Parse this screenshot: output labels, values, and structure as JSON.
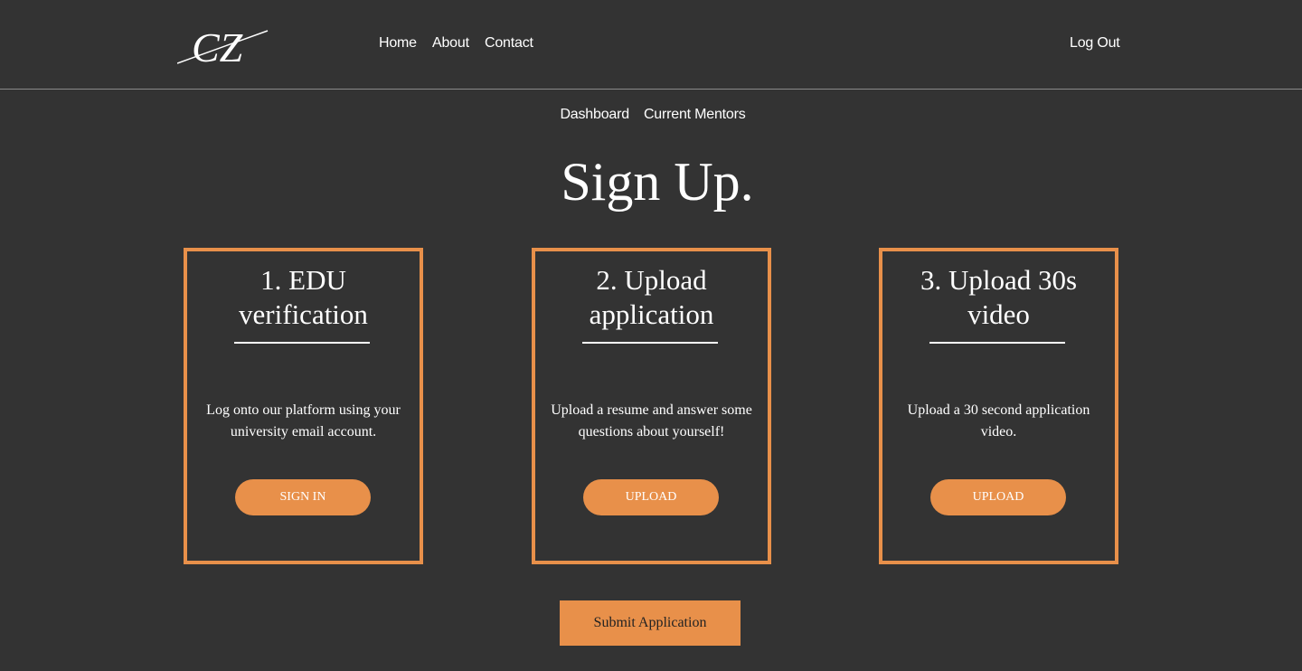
{
  "brand": {
    "logo_text": "CZ"
  },
  "nav": {
    "home": "Home",
    "about": "About",
    "contact": "Contact",
    "logout": "Log Out"
  },
  "subnav": {
    "dashboard": "Dashboard",
    "mentors": "Current Mentors"
  },
  "page": {
    "title": "Sign Up."
  },
  "steps": [
    {
      "title_line1": "1. EDU",
      "title_line2": "verification",
      "description": "Log onto our platform using your university email account.",
      "button": "Sign In"
    },
    {
      "title_line1": "2. Upload",
      "title_line2": "application",
      "description": "Upload a resume and answer some questions about yourself!",
      "button": "Upload"
    },
    {
      "title_line1": "3. Upload 30s",
      "title_line2": "video",
      "description": "Upload a 30 second application video.",
      "button": "Upload"
    }
  ],
  "submit": {
    "label": "Submit Application"
  },
  "colors": {
    "background": "#333333",
    "accent": "#e8904a",
    "text": "#ffffff"
  }
}
